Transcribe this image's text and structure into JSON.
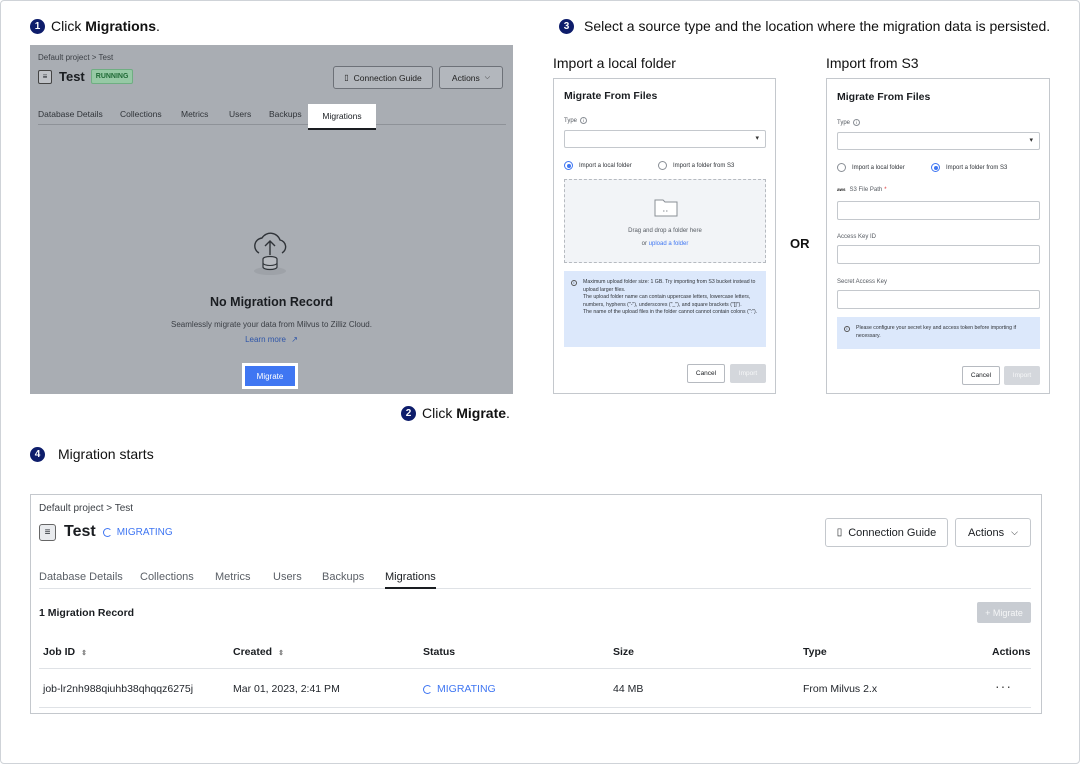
{
  "steps": {
    "one": {
      "num": "1",
      "prefix": "Click ",
      "bold": "Migrations",
      "suffix": "."
    },
    "two": {
      "num": "2",
      "prefix": "Click ",
      "bold": "Migrate",
      "suffix": "."
    },
    "three": {
      "num": "3",
      "text": "Select a source type and the location where the migration data is persisted."
    },
    "four": {
      "num": "4",
      "text": "Migration starts"
    }
  },
  "step1": {
    "breadcrumb": "Default project > Test",
    "title": "Test",
    "status": "RUNNING",
    "connection_guide": "Connection Guide",
    "actions": "Actions",
    "tabs": [
      "Database Details",
      "Collections",
      "Metrics",
      "Users",
      "Backups",
      "Migrations"
    ],
    "empty_title": "No Migration Record",
    "empty_sub": "Seamlessly migrate your data from Milvus to Zilliz Cloud.",
    "learn_more": "Learn more",
    "migrate_btn": "Migrate"
  },
  "local_panel": {
    "head": "Import a  local folder",
    "title": "Migrate From Files",
    "type_label": "Type",
    "radio_local": "Import a local folder",
    "radio_s3": "Import a folder from S3",
    "drop_text": "Drag and drop a folder here",
    "drop_or": "or ",
    "drop_link": "upload a folder",
    "note_lines": [
      "Maximum upload folder size: 1 GB. Try importing from S3 bucket instead to upload larger files.",
      "The upload folder name can contain uppercase letters, lowercase letters, numbers, hyphens (\"-\"), underscores (\"_\"), and square brackets (\"[]\").",
      "The name of the upload files in the folder cannot cannot contain colons (\":\")."
    ],
    "cancel": "Cancel",
    "import": "Import"
  },
  "or_text": "OR",
  "s3_panel": {
    "head": "Import from S3",
    "title": "Migrate From Files",
    "type_label": "Type",
    "radio_local": "Import a local folder",
    "radio_s3": "Import a folder from S3",
    "s3_path_label": "S3 File Path",
    "access_key_label": "Access Key ID",
    "secret_key_label": "Secret Access Key",
    "note": "Please configure your secret key and access token before importing if necessary.",
    "cancel": "Cancel",
    "import": "Import"
  },
  "step4": {
    "breadcrumb": "Default project > Test",
    "title": "Test",
    "status": "MIGRATING",
    "connection_guide": "Connection Guide",
    "actions": "Actions",
    "tabs": [
      "Database Details",
      "Collections",
      "Metrics",
      "Users",
      "Backups",
      "Migrations"
    ],
    "record_count": "1 Migration Record",
    "add_migrate": "+ Migrate",
    "columns": [
      "Job ID",
      "Created",
      "Status",
      "Size",
      "Type",
      "Actions"
    ],
    "rows": [
      {
        "job_id": "job-lr2nh988qiuhb38qhqqz6275j",
        "created": "Mar 01, 2023, 2:41 PM",
        "status": "MIGRATING",
        "size": "44 MB",
        "type": "From Milvus 2.x",
        "actions": "···"
      }
    ]
  },
  "colors": {
    "accent": "#3f76f2",
    "step_badge": "#0e1d6b",
    "running": "#1f6a36"
  }
}
